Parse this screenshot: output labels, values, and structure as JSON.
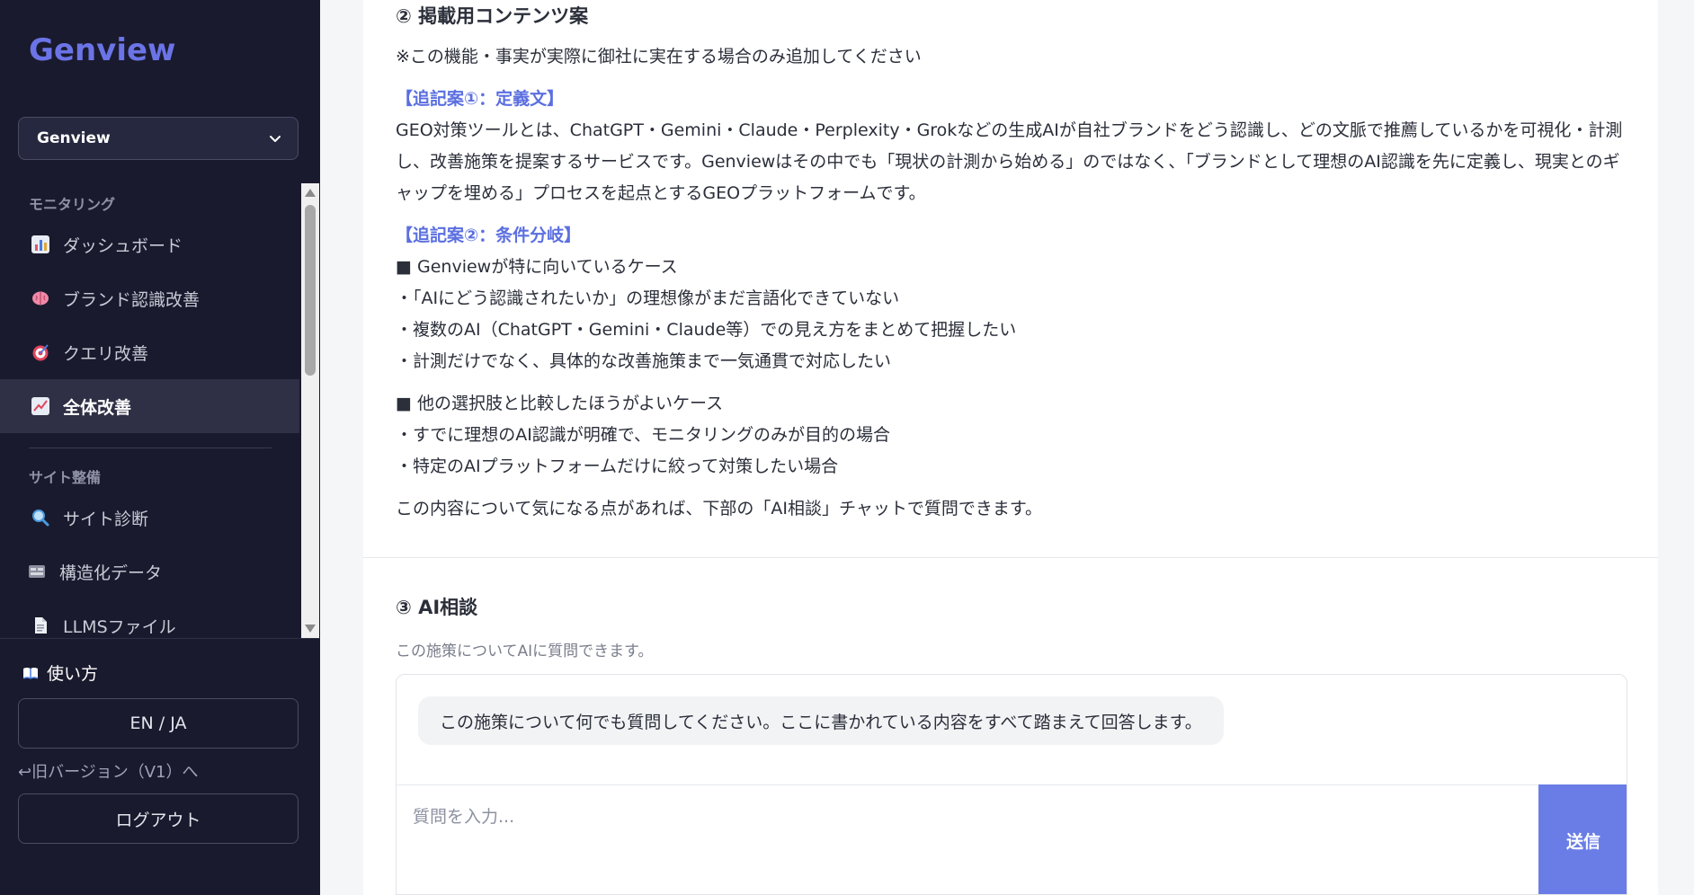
{
  "sidebar": {
    "logo": "Genview",
    "brand_select": "Genview",
    "sections": {
      "monitoring": "モニタリング",
      "site": "サイト整備"
    },
    "items": [
      {
        "label": "ダッシュボード",
        "icon": "bar-chart-icon"
      },
      {
        "label": "ブランド認識改善",
        "icon": "brain-icon"
      },
      {
        "label": "クエリ改善",
        "icon": "target-icon"
      },
      {
        "label": "全体改善",
        "icon": "trend-up-icon",
        "active": true
      },
      {
        "label": "サイト診断",
        "icon": "magnifier-icon"
      },
      {
        "label": "構造化データ",
        "icon": "schema-icon"
      },
      {
        "label": "LLMSファイル",
        "icon": "document-icon"
      }
    ],
    "howto": "使い方",
    "lang_toggle": "EN / JA",
    "old_version": "↩旧バージョン（V1）へ",
    "logout": "ログアウト"
  },
  "content": {
    "section2_title": "② 掲載用コンテンツ案",
    "note": "※この機能・事実が実際に御社に実在する場合のみ追加してください",
    "proposal1_title": "【追記案①：定義文】",
    "proposal1_body": "GEO対策ツールとは、ChatGPT・Gemini・Claude・Perplexity・Grokなどの生成AIが自社ブランドをどう認識し、どの文脈で推薦しているかを可視化・計測し、改善施策を提案するサービスです。Genviewはその中でも「現状の計測から始める」のではなく、「ブランドとして理想のAI認識を先に定義し、現実とのギャップを埋める」プロセスを起点とするGEOプラットフォームです。",
    "proposal2_title": "【追記案②：条件分岐】",
    "case_good_title": "■ Genviewが特に向いているケース",
    "case_good_items": [
      "・「AIにどう認識されたいか」の理想像がまだ言語化できていない",
      "・複数のAI（ChatGPT・Gemini・Claude等）での見え方をまとめて把握したい",
      "・計測だけでなく、具体的な改善施策まで一気通貫で対応したい"
    ],
    "case_other_title": "■ 他の選択肢と比較したほうがよいケース",
    "case_other_items": [
      "・すでに理想のAI認識が明確で、モニタリングのみが目的の場合",
      "・特定のAIプラットフォームだけに絞って対策したい場合"
    ],
    "footer_note": "この内容について気になる点があれば、下部の「AI相談」チャットで質問できます。",
    "section3_title": "③ AI相談",
    "section3_desc": "この施策についてAIに質問できます。",
    "chat_greeting": "この施策について何でも質問してください。ここに書かれている内容をすべて踏まえて回答します。",
    "chat_placeholder": "質問を入力...",
    "send_label": "送信"
  },
  "colors": {
    "sidebar_bg": "#1a1a2e",
    "accent": "#6a7de6",
    "logo": "#6b74e6"
  }
}
